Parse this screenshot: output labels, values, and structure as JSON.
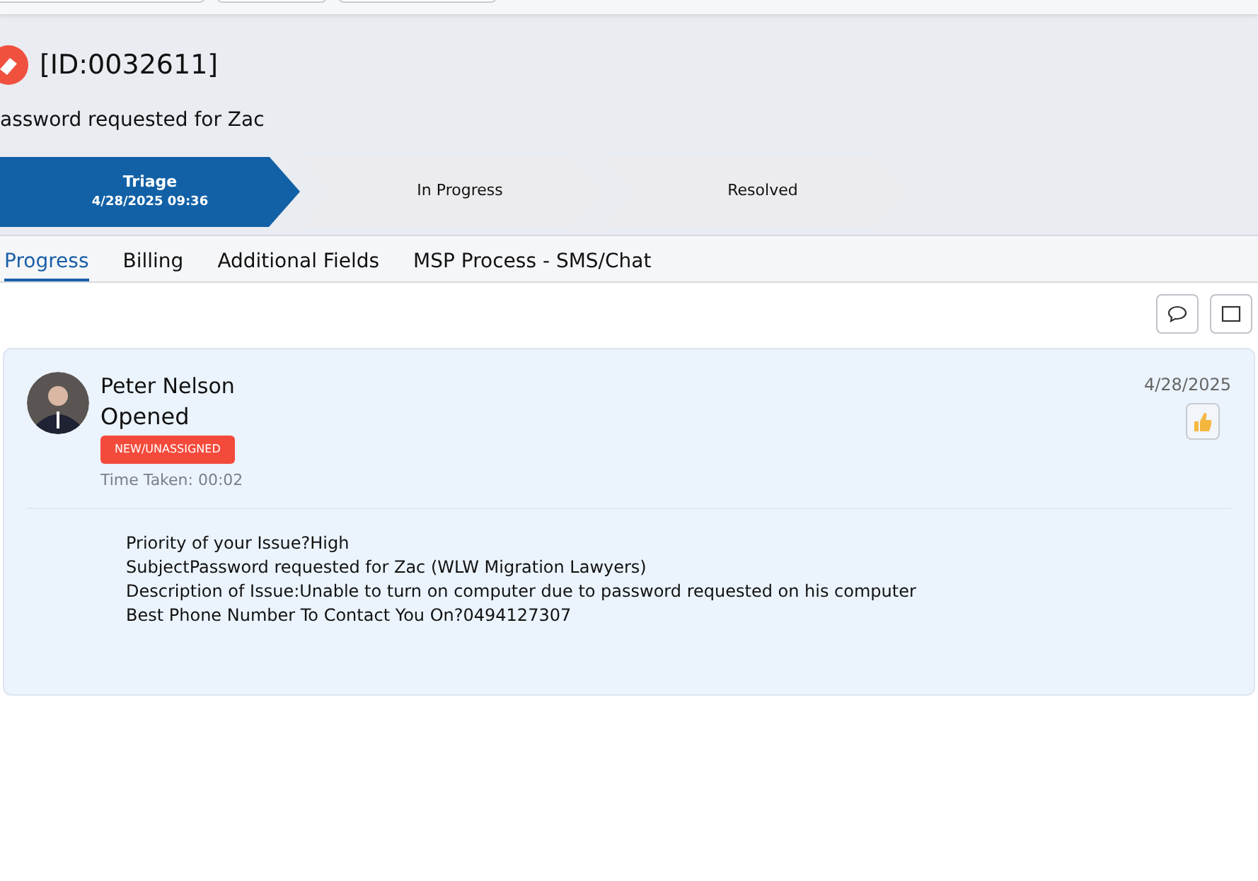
{
  "ticket": {
    "id": "[ID:0032611]",
    "subject": "assword requested for Zac"
  },
  "stages": [
    {
      "label": "Triage",
      "date": "4/28/2025 09:36",
      "selected": true
    },
    {
      "label": "In Progress",
      "selected": false
    },
    {
      "label": "Resolved",
      "selected": false
    }
  ],
  "tabs": [
    {
      "label": "Progress",
      "selected": true
    },
    {
      "label": "Billing",
      "selected": false
    },
    {
      "label": "Additional Fields",
      "selected": false
    },
    {
      "label": "MSP Process - SMS/Chat",
      "selected": false
    }
  ],
  "entry": {
    "author": "Peter Nelson",
    "action": "Opened",
    "status": "NEW/UNASSIGNED",
    "time_taken": "Time Taken: 00:02",
    "date": "4/28/2025",
    "lines": [
      "Priority of your Issue?High",
      "SubjectPassword requested for Zac (WLW Migration Lawyers)",
      "Description of Issue:Unable to turn on computer due to password requested on his computer",
      "Best Phone Number To Contact You On?0494127307"
    ]
  }
}
